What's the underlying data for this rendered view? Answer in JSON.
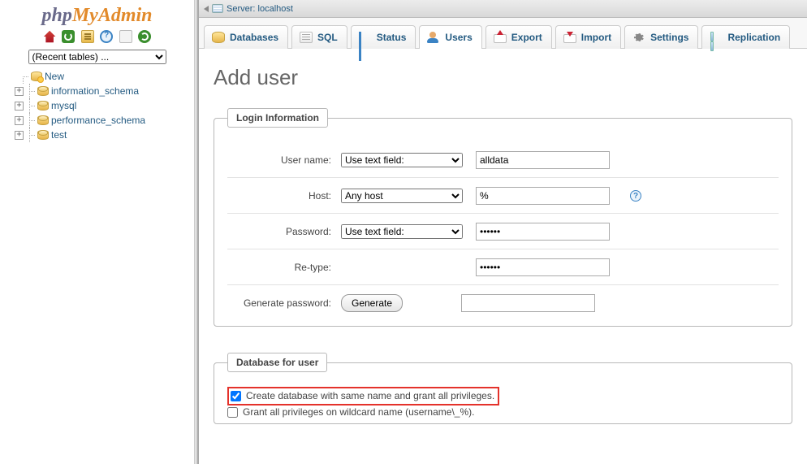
{
  "logo": {
    "p1": "php",
    "p2": "MyAdmin"
  },
  "recent_placeholder": "(Recent tables) ...",
  "tree": {
    "new_label": "New",
    "dbs": [
      "information_schema",
      "mysql",
      "performance_schema",
      "test"
    ]
  },
  "breadcrumb": {
    "prefix": "Server:",
    "server": "localhost"
  },
  "tabs": [
    {
      "id": "databases",
      "label": "Databases"
    },
    {
      "id": "sql",
      "label": "SQL"
    },
    {
      "id": "status",
      "label": "Status"
    },
    {
      "id": "users",
      "label": "Users",
      "active": true
    },
    {
      "id": "export",
      "label": "Export"
    },
    {
      "id": "import",
      "label": "Import"
    },
    {
      "id": "settings",
      "label": "Settings"
    },
    {
      "id": "replication",
      "label": "Replication"
    }
  ],
  "page_title": "Add user",
  "login_info": {
    "legend": "Login Information",
    "username_label": "User name:",
    "username_mode": "Use text field:",
    "username_value": "alldata",
    "host_label": "Host:",
    "host_mode": "Any host",
    "host_value": "%",
    "password_label": "Password:",
    "password_mode": "Use text field:",
    "password_value": "......",
    "retype_label": "Re-type:",
    "retype_value": "......",
    "generate_label": "Generate password:",
    "generate_button": "Generate",
    "generate_value": ""
  },
  "dbforuser": {
    "legend": "Database for user",
    "opt1": "Create database with same name and grant all privileges.",
    "opt1_checked": true,
    "opt2": "Grant all privileges on wildcard name (username\\_%).",
    "opt2_checked": false
  },
  "help_symbol": "?"
}
